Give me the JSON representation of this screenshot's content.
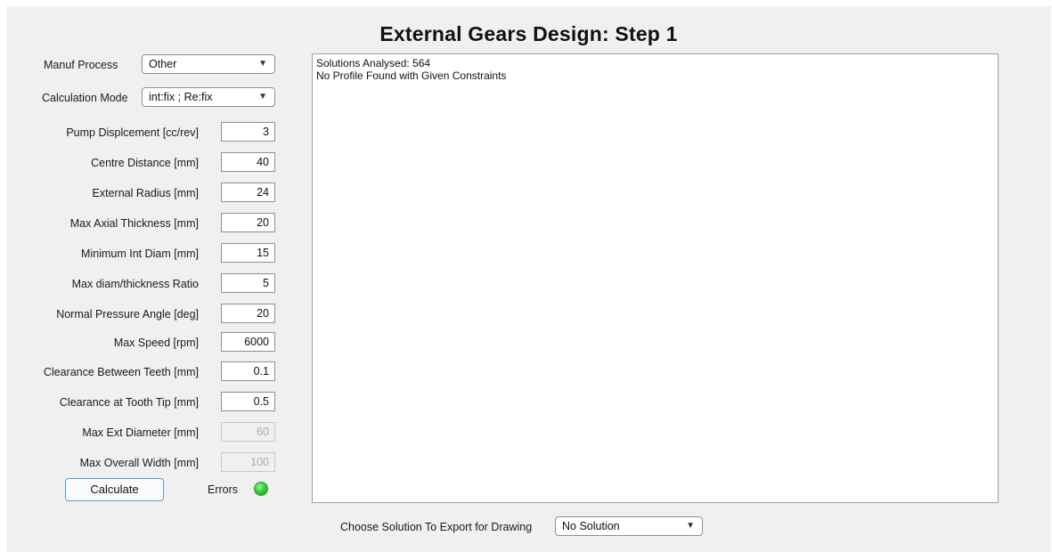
{
  "window": {
    "title": "External Gears Design: Step 1"
  },
  "form": {
    "manuf_process": {
      "label": "Manuf Process",
      "value": "Other"
    },
    "calc_mode": {
      "label": "Calculation Mode",
      "value": "int:fix ; Re:fix"
    },
    "fields": [
      {
        "label": "Pump Displcement [cc/rev]",
        "value": "3",
        "enabled": true
      },
      {
        "label": "Centre Distance [mm]",
        "value": "40",
        "enabled": true
      },
      {
        "label": "External Radius [mm]",
        "value": "24",
        "enabled": true
      },
      {
        "label": "Max Axial Thickness [mm]",
        "value": "20",
        "enabled": true
      },
      {
        "label": "Minimum Int Diam [mm]",
        "value": "15",
        "enabled": true
      },
      {
        "label": "Max diam/thickness Ratio",
        "value": "5",
        "enabled": true
      },
      {
        "label": "Normal Pressure Angle [deg]",
        "value": "20",
        "enabled": true
      },
      {
        "label": "Max Speed [rpm]",
        "value": "6000",
        "enabled": true
      },
      {
        "label": "Clearance Between Teeth [mm]",
        "value": "0.1",
        "enabled": true
      },
      {
        "label": "Clearance at Tooth Tip [mm]",
        "value": "0.5",
        "enabled": true
      },
      {
        "label": "Max Ext Diameter [mm]",
        "value": "60",
        "enabled": false
      },
      {
        "label": "Max Overall Width [mm]",
        "value": "100",
        "enabled": false
      }
    ],
    "calculate_label": "Calculate",
    "errors_label": "Errors",
    "errors_led_color": "#2bd42b"
  },
  "output": {
    "lines": [
      "Solutions Analysed: 564",
      "No Profile Found with Given Constraints"
    ]
  },
  "export": {
    "label": "Choose Solution To Export for Drawing",
    "value": "No Solution"
  }
}
